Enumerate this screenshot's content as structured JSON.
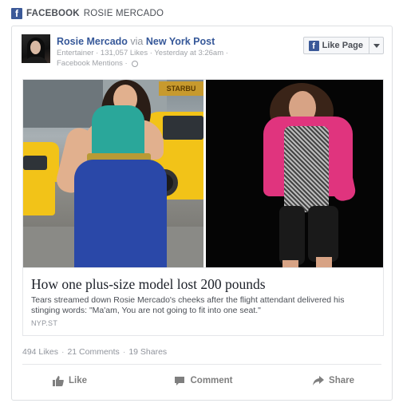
{
  "header": {
    "brand": "FACEBOOK",
    "page_name": "ROSIE MERCADO",
    "icon": "facebook-logo-icon"
  },
  "post": {
    "author": "Rosie Mercado",
    "via": "via",
    "source": "New York Post",
    "meta_line": "Entertainer · 131,057 Likes · Yesterday at 3:26am ·",
    "mentions": "Facebook Mentions ·",
    "privacy_icon": "globe-icon",
    "like_page_label": "Like Page"
  },
  "media": {
    "left_sign_text": "STARBU"
  },
  "article": {
    "title": "How one plus-size model lost 200 pounds",
    "description": "Tears streamed down Rosie Mercado's cheeks after the flight attendant delivered his stinging words: \"Ma'am, You are not going to fit into one seat.\"",
    "source": "NYP.ST"
  },
  "stats": {
    "likes": "494 Likes",
    "comments": "21 Comments",
    "shares": "19 Shares",
    "separator": "·"
  },
  "actions": {
    "like": "Like",
    "comment": "Comment",
    "share": "Share"
  },
  "colors": {
    "facebook_blue": "#3b5998",
    "link_blue": "#365899",
    "meta_gray": "#90949c"
  }
}
